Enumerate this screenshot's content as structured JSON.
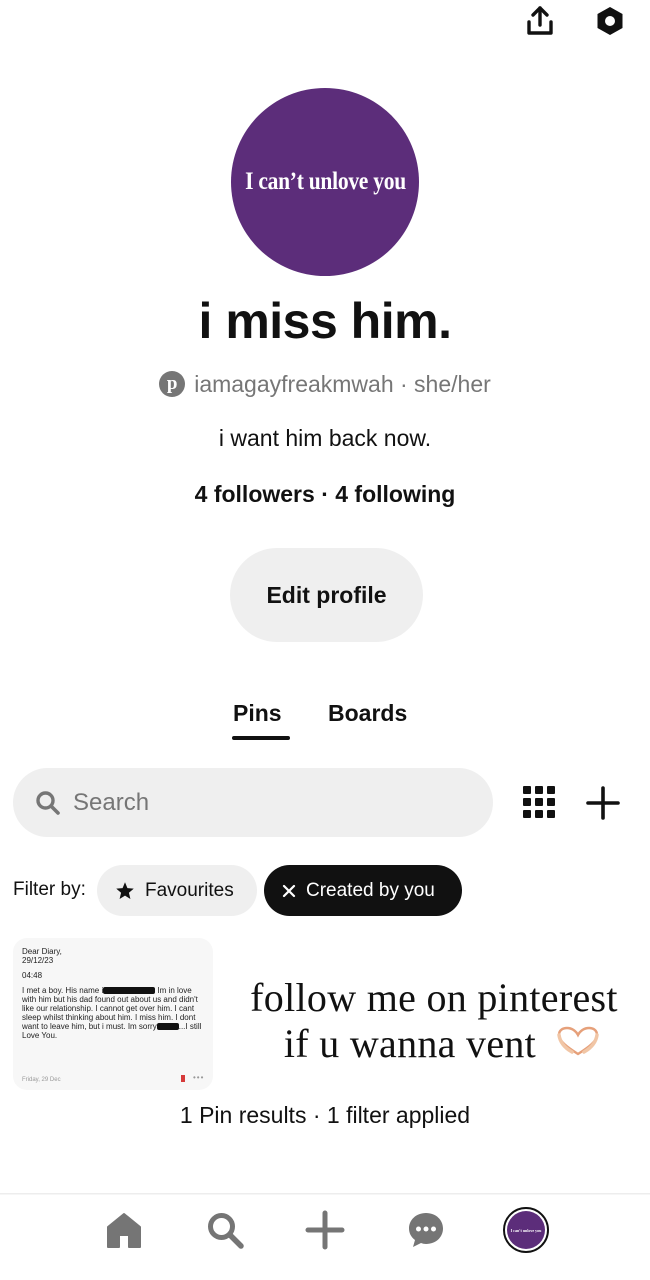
{
  "header": {
    "share_icon": "share-upload-icon",
    "settings_icon": "settings-hexagon-icon"
  },
  "profile": {
    "avatar_text": "I can’t unlove you",
    "name": "i miss him.",
    "platform_icon": "pinterest-logo-icon",
    "handle_line": "iamagayfreakmwah · she/her",
    "bio": "i want him back now.",
    "follow_line": "4 followers · 4 following",
    "edit_button": "Edit profile"
  },
  "tabs": [
    {
      "label": "Pins",
      "active": true
    },
    {
      "label": "Boards",
      "active": false
    }
  ],
  "search": {
    "placeholder": "Search",
    "value": ""
  },
  "filter": {
    "label": "Filter by:",
    "chips": [
      {
        "label": "Favourites",
        "icon": "star-icon",
        "selected": false
      },
      {
        "label": "Created by you",
        "icon": "x-icon",
        "selected": true
      }
    ]
  },
  "pin": {
    "heading": "Dear Diary,",
    "date": "29/12/23",
    "time": "04:48",
    "body_1": "I met a boy. His name i",
    "body_2": " Im in love with him but his dad found out about us and didn't like our relationship. I cannot get over him. I cant sleep whilst thinking about him. I miss him. I dont want to leave him, but i must. Im sorry",
    "body_3": "...I still Love You.",
    "footer_date": "Friday, 29 Dec",
    "footer_dots": "•••"
  },
  "overlay_caption": {
    "line1": "follow me on pinterest",
    "line2": "if u wanna vent"
  },
  "results": "1 Pin results · 1 filter applied",
  "bottom_nav": [
    {
      "icon": "home-icon"
    },
    {
      "icon": "search-icon"
    },
    {
      "icon": "plus-icon"
    },
    {
      "icon": "messages-icon"
    },
    {
      "icon": "profile-avatar",
      "label": "I can’t unlove you"
    }
  ],
  "colors": {
    "avatar_bg": "#5c2d7a",
    "chip_active_bg": "#111111",
    "chip_bg": "#efefef",
    "muted_text": "#767676"
  }
}
